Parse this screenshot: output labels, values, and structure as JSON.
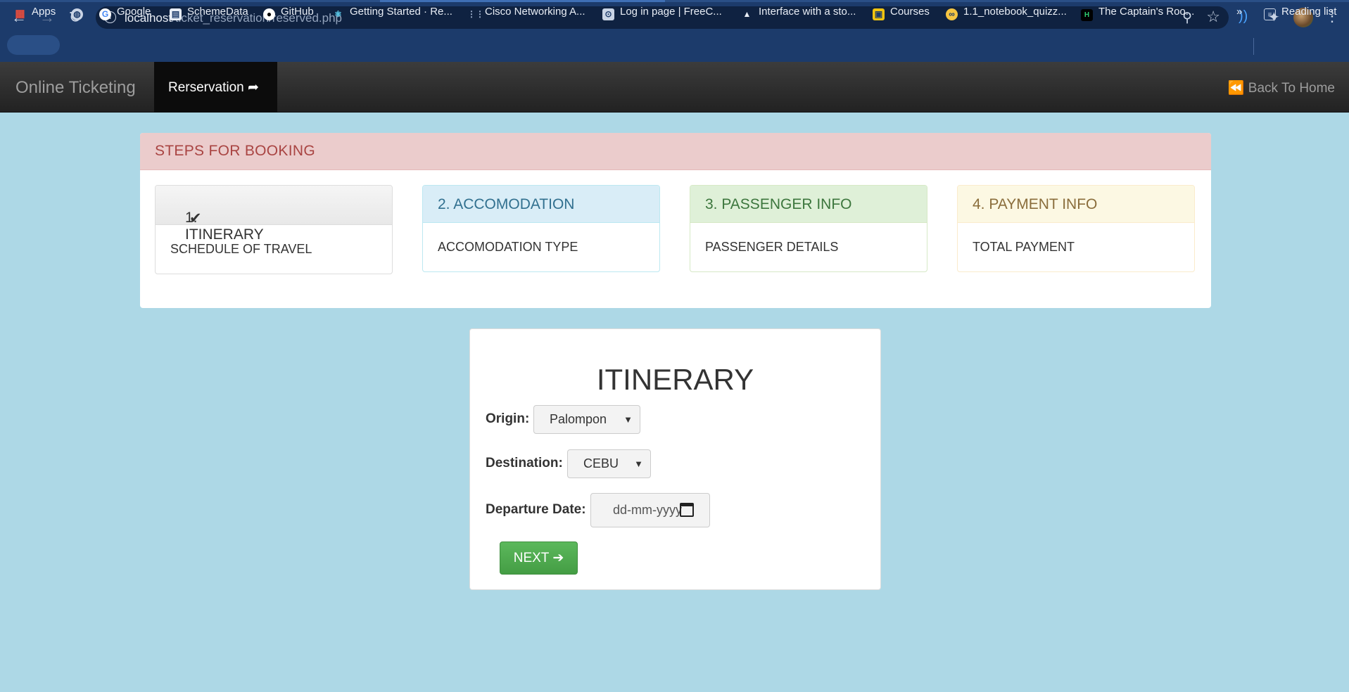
{
  "browser": {
    "url_host": "localhost",
    "url_path": "/ticket_reservation/reserved.php",
    "bookmarks": [
      {
        "label": "Apps"
      },
      {
        "label": ""
      },
      {
        "label": "Google"
      },
      {
        "label": "SchemeData"
      },
      {
        "label": "GitHub"
      },
      {
        "label": "Getting Started · Re..."
      },
      {
        "label": "Cisco Networking A..."
      },
      {
        "label": "Log in page | FreeC..."
      },
      {
        "label": "Interface with a sto..."
      },
      {
        "label": "Courses"
      },
      {
        "label": "1.1_notebook_quizz..."
      },
      {
        "label": "The Captain's Roo..."
      }
    ],
    "more": "»",
    "reading_list": "Reading list"
  },
  "navbar": {
    "brand": "Online Ticketing",
    "active": "Rerservation ➦",
    "back": "⏪ Back To Home"
  },
  "steps": {
    "heading": "STEPS FOR BOOKING",
    "items": [
      {
        "title": "1. ITINERARY",
        "body": "SCHEDULE OF TRAVEL"
      },
      {
        "title": "2. ACCOMODATION",
        "body": "ACCOMODATION TYPE"
      },
      {
        "title": "3. PASSENGER INFO",
        "body": "PASSENGER DETAILS"
      },
      {
        "title": "4. PAYMENT INFO",
        "body": "TOTAL PAYMENT"
      }
    ]
  },
  "form": {
    "title": "ITINERARY",
    "origin_label": "Origin:",
    "origin_value": "Palompon",
    "destination_label": "Destination:",
    "destination_value": "CEBU",
    "date_label": "Departure Date:",
    "date_placeholder": "dd-mm-yyyy",
    "next_label": "NEXT ➔"
  }
}
